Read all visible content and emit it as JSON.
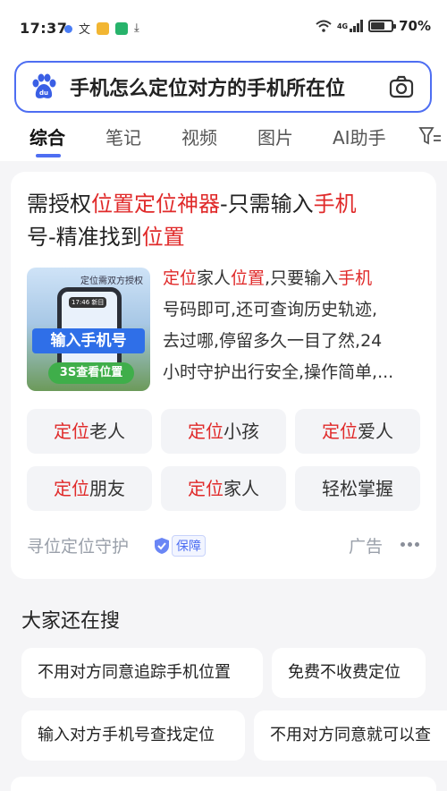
{
  "status_bar": {
    "time": "17:37",
    "battery": "70%",
    "network": "4G"
  },
  "search": {
    "query": "手机怎么定位对方的手机所在位"
  },
  "tabs": [
    {
      "label": "综合",
      "active": true
    },
    {
      "label": "笔记",
      "active": false
    },
    {
      "label": "视频",
      "active": false
    },
    {
      "label": "图片",
      "active": false
    },
    {
      "label": "AI助手",
      "active": false
    }
  ],
  "ad": {
    "title_parts": [
      "需授权",
      "位置定位神器",
      "-只需输入",
      "手机",
      "号-精准找到",
      "位置"
    ],
    "thumbnail": {
      "caption": "定位需双方授权",
      "phone_time": "17:46 新目",
      "banner": "输入手机号",
      "button": "3S查看位置"
    },
    "desc_lines": [
      [
        "定位",
        "家人",
        "位置",
        ",只要输入",
        "手机"
      ],
      [
        "号码即可,还可查询历史轨迹,"
      ],
      [
        "去过哪,停留多久一目了然,24"
      ],
      [
        "小时守护出行安全,操作简单,..."
      ]
    ],
    "chips": [
      {
        "hl": "定位",
        "rest": "老人"
      },
      {
        "hl": "定位",
        "rest": "小孩"
      },
      {
        "hl": "定位",
        "rest": "爱人"
      },
      {
        "hl": "定位",
        "rest": "朋友"
      },
      {
        "hl": "定位",
        "rest": "家人"
      },
      {
        "hl": "",
        "rest": "轻松掌握"
      }
    ],
    "source": "寻位定位守护",
    "guarantee": "保障",
    "ad_label": "广告"
  },
  "related": {
    "title": "大家还在搜",
    "items": [
      "不用对方同意追踪手机位置",
      "免费不收费定位",
      "输入对方手机号查找定位",
      "不用对方同意就可以查"
    ]
  },
  "colors": {
    "accent": "#4e6ef2",
    "highlight": "#e02a2a",
    "background": "#f5f5f7"
  }
}
